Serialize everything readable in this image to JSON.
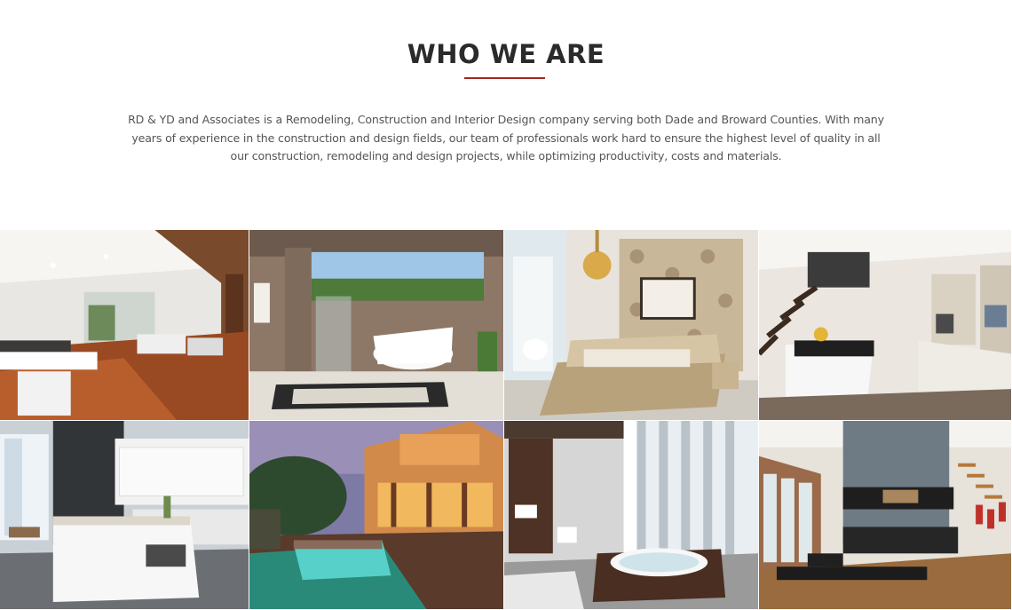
{
  "section": {
    "title": "WHO WE ARE",
    "description": "RD & YD and Associates is a Remodeling, Construction and Interior Design company serving both Dade and Broward Counties. With many years of experience in the construction and design fields, our team of professionals work hard to ensure the highest level of quality in all our construction, remodeling and design projects, while optimizing productivity, costs and materials."
  },
  "colors": {
    "accent": "#a6231e",
    "heading": "#2b2b2b",
    "body_text": "#555555"
  },
  "gallery": {
    "images": [
      {
        "name": "open-living-room-photo"
      },
      {
        "name": "bathroom-bathtub-photo"
      },
      {
        "name": "bedroom-wallpaper-photo"
      },
      {
        "name": "kitchen-staircase-photo"
      },
      {
        "name": "white-kitchen-island-photo"
      },
      {
        "name": "house-pool-night-photo"
      },
      {
        "name": "spa-bathroom-photo"
      },
      {
        "name": "loft-kitchen-photo"
      }
    ]
  }
}
